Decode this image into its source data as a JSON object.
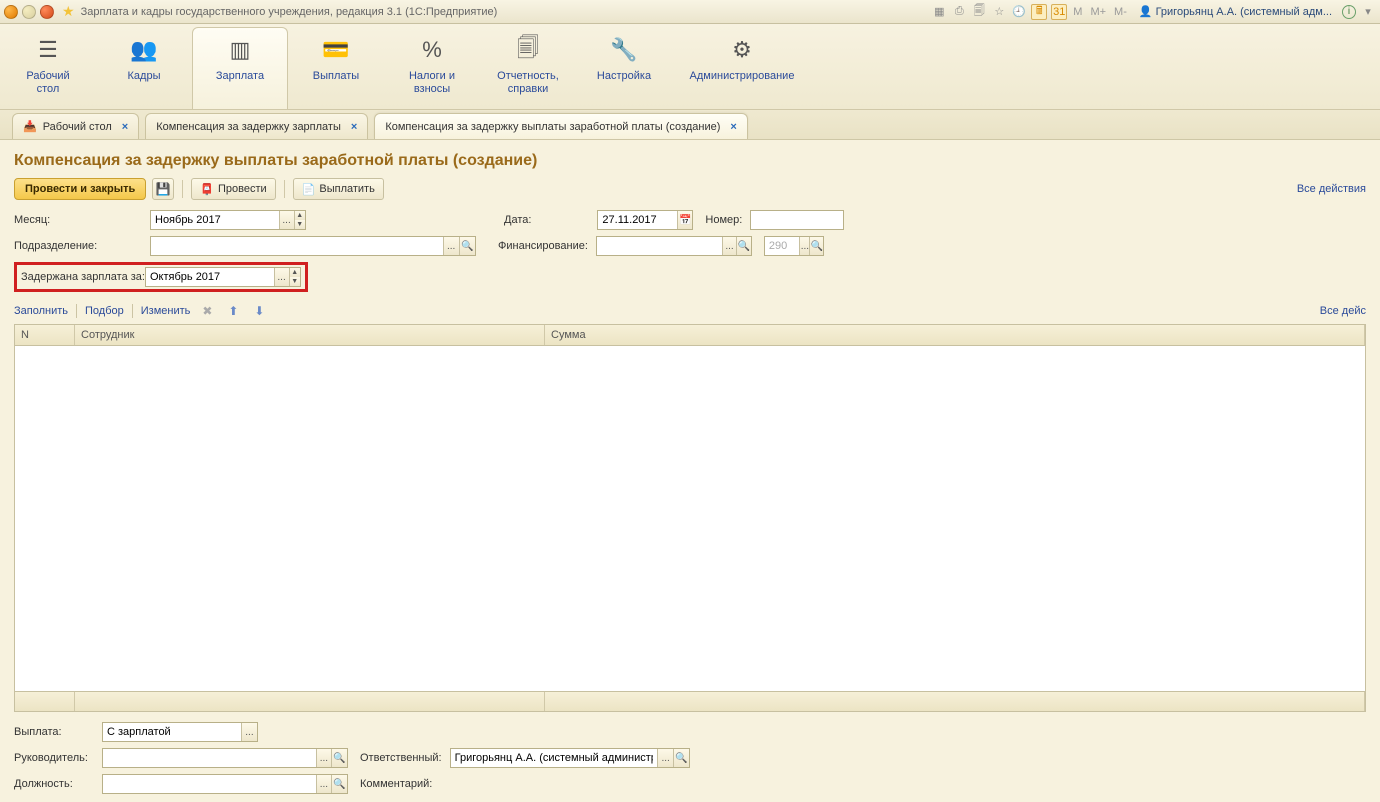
{
  "titlebar": {
    "title": "Зарплата и кадры государственного учреждения, редакция 3.1  (1С:Предприятие)",
    "user": "Григорьянц А.А. (системный адм...",
    "m": "M",
    "m_plus": "M+",
    "m_minus": "M-"
  },
  "sections": [
    {
      "label": "Рабочий\nстол",
      "icon": "☰"
    },
    {
      "label": "Кадры",
      "icon": "👥"
    },
    {
      "label": "Зарплата",
      "icon": "▥",
      "active": true
    },
    {
      "label": "Выплаты",
      "icon": "💳"
    },
    {
      "label": "Налоги и\nвзносы",
      "icon": "%"
    },
    {
      "label": "Отчетность,\nсправки",
      "icon": "🗐"
    },
    {
      "label": "Настройка",
      "icon": "🔧"
    },
    {
      "label": "Администрирование",
      "icon": "⚙"
    }
  ],
  "tabs": [
    {
      "label": "Рабочий стол",
      "home": true
    },
    {
      "label": "Компенсация за задержку зарплаты"
    },
    {
      "label": "Компенсация за задержку выплаты заработной платы (создание)",
      "active": true
    }
  ],
  "page": {
    "title": "Компенсация за задержку выплаты заработной платы (создание)",
    "btn_main": "Провести и закрыть",
    "btn_provesti": "Провести",
    "btn_vyplatit": "Выплатить",
    "all_actions": "Все действия"
  },
  "form": {
    "month_label": "Месяц:",
    "month_value": "Ноябрь 2017",
    "date_label": "Дата:",
    "date_value": "27.11.2017",
    "number_label": "Номер:",
    "number_value": "",
    "dept_label": "Подразделение:",
    "dept_value": "",
    "fin_label": "Финансирование:",
    "fin_value": "",
    "fin2_value": "290",
    "delayed_label": "Задержана зарплата за:",
    "delayed_value": "Октябрь 2017"
  },
  "tbl_toolbar": {
    "fill": "Заполнить",
    "select": "Подбор",
    "change": "Изменить",
    "all_actions2": "Все дейс"
  },
  "table": {
    "col_n": "N",
    "col_emp": "Сотрудник",
    "col_sum": "Сумма"
  },
  "bottom": {
    "vyplata_label": "Выплата:",
    "vyplata_value": "С зарплатой",
    "ruk_label": "Руководитель:",
    "ruk_value": "",
    "resp_label": "Ответственный:",
    "resp_value": "Григорьянц А.А. (системный администрат",
    "dolzh_label": "Должность:",
    "dolzh_value": "",
    "comment_label": "Комментарий:"
  }
}
